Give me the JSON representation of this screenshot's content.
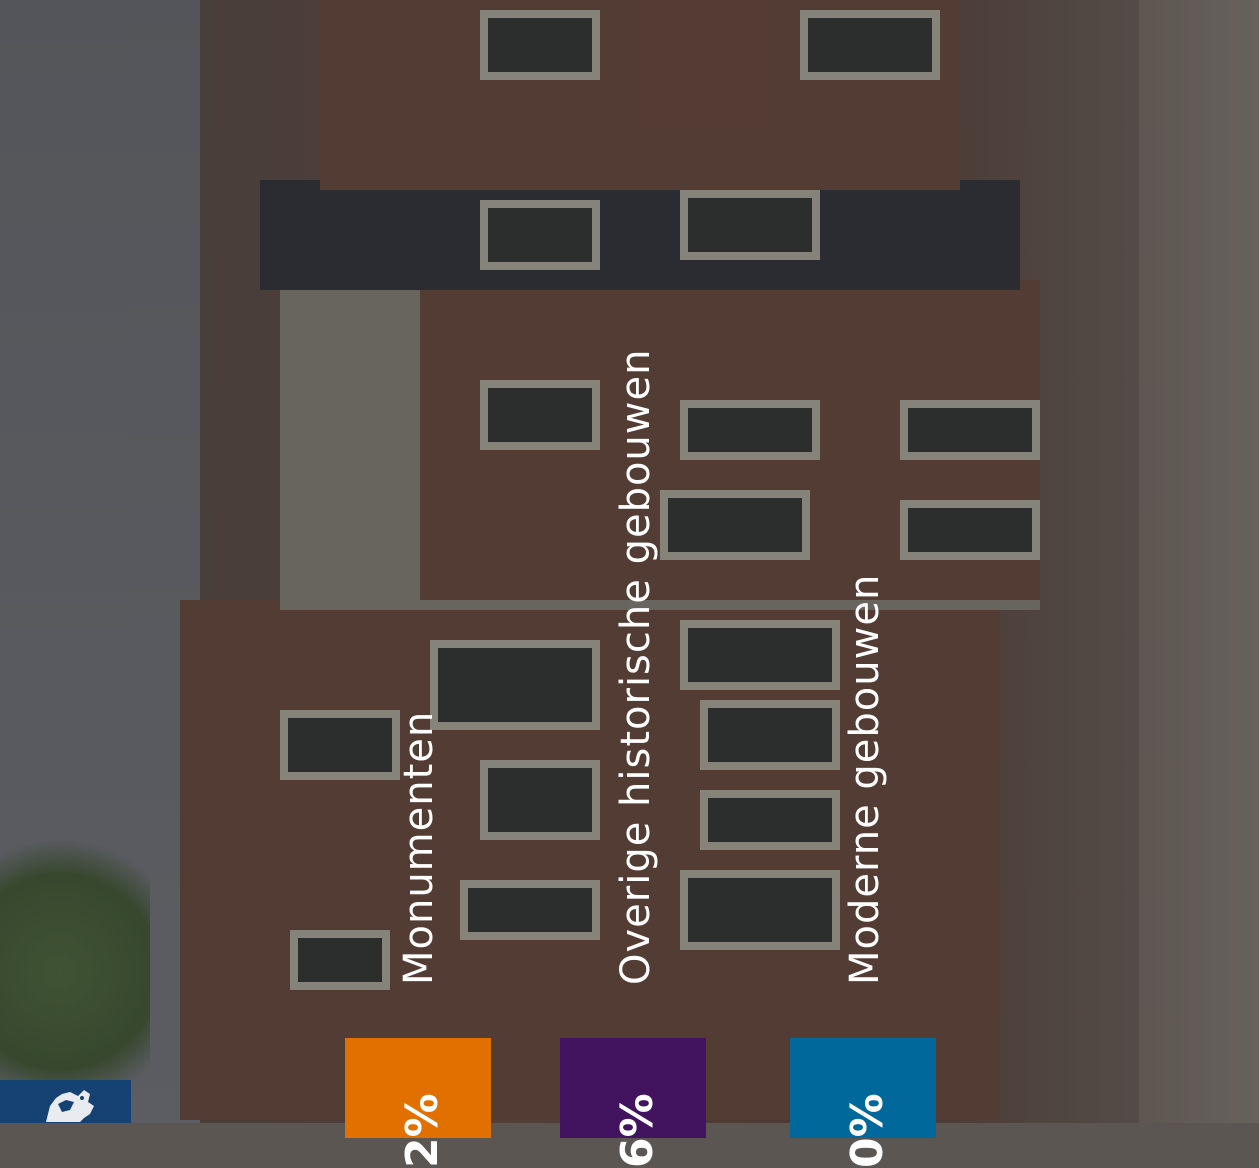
{
  "colors": {
    "orange": "#e17000",
    "purple": "#42145f",
    "blue": "#01689b",
    "logo_blue": "#154273"
  },
  "categories": [
    {
      "label": "Monumenten",
      "percent": "2%"
    },
    {
      "label": "Overige historische gebouwen",
      "percent": "6%"
    },
    {
      "label": "Moderne gebouwen",
      "percent": "0%"
    }
  ],
  "logo": {
    "icon": "rijksoverheid-lion-emblem-icon"
  }
}
